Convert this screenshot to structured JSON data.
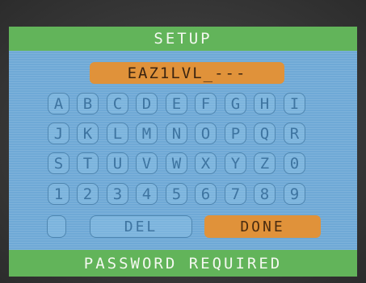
{
  "screen": {
    "title": "SETUP",
    "password_value": "EAZ1LVL_---",
    "status": "PASSWORD REQUIRED"
  },
  "keypad": {
    "rows": [
      [
        "A",
        "B",
        "C",
        "D",
        "E",
        "F",
        "G",
        "H",
        "I"
      ],
      [
        "J",
        "K",
        "L",
        "M",
        "N",
        "O",
        "P",
        "Q",
        "R"
      ],
      [
        "S",
        "T",
        "U",
        "V",
        "W",
        "X",
        "Y",
        "Z",
        "0"
      ],
      [
        "1",
        "2",
        "3",
        "4",
        "5",
        "6",
        "7",
        "8",
        "9"
      ]
    ],
    "del_label": "DEL",
    "done_label": "DONE"
  },
  "colors": {
    "bar_green": "#62b45a",
    "screen_blue": "#6fa9d6",
    "accent_orange": "#e0923a"
  }
}
